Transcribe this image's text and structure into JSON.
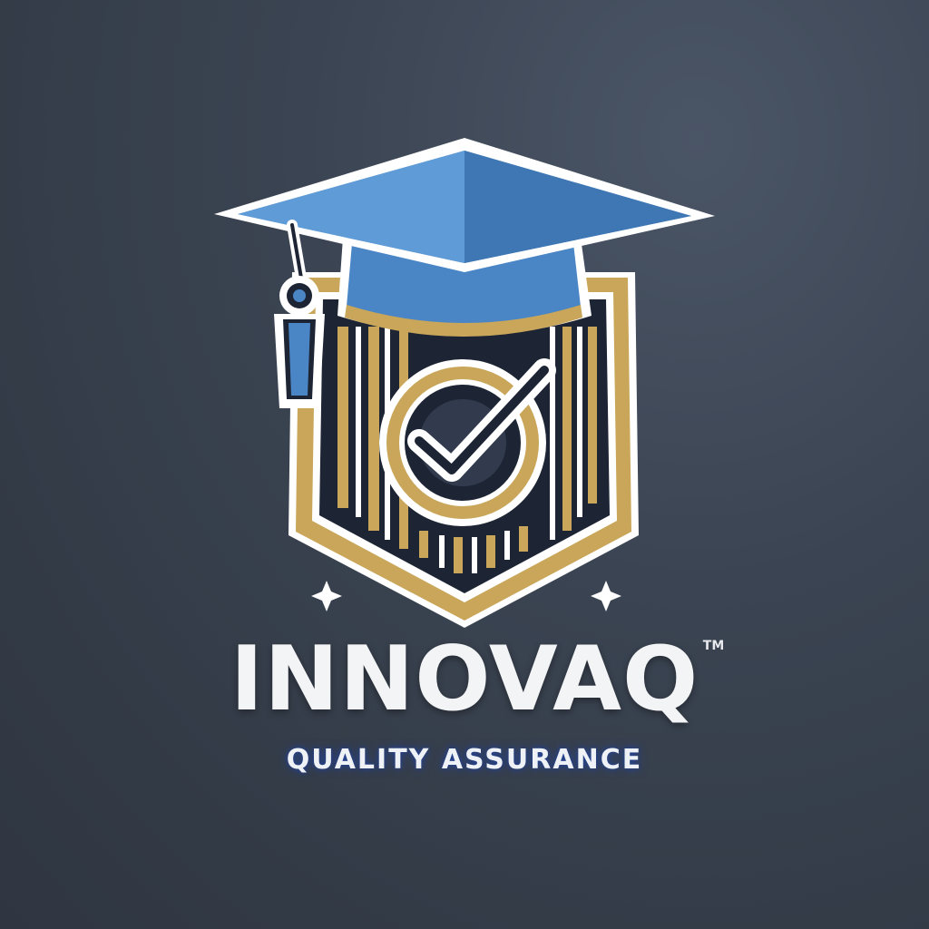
{
  "brand": {
    "name": "INNOVAQ",
    "trademark": "TM",
    "tagline": "QUALITY ASSURANCE"
  },
  "logo": {
    "icons": [
      "graduation-cap-icon",
      "tassel-icon",
      "shield-icon",
      "checkmark-icon",
      "sparkle-icon"
    ]
  },
  "colors": {
    "background": "#3b4452",
    "cap_blue": "#4a86c5",
    "gold": "#c9a659",
    "navy": "#1d2434",
    "outline": "#ffffff",
    "text": "#f3f4f6"
  }
}
